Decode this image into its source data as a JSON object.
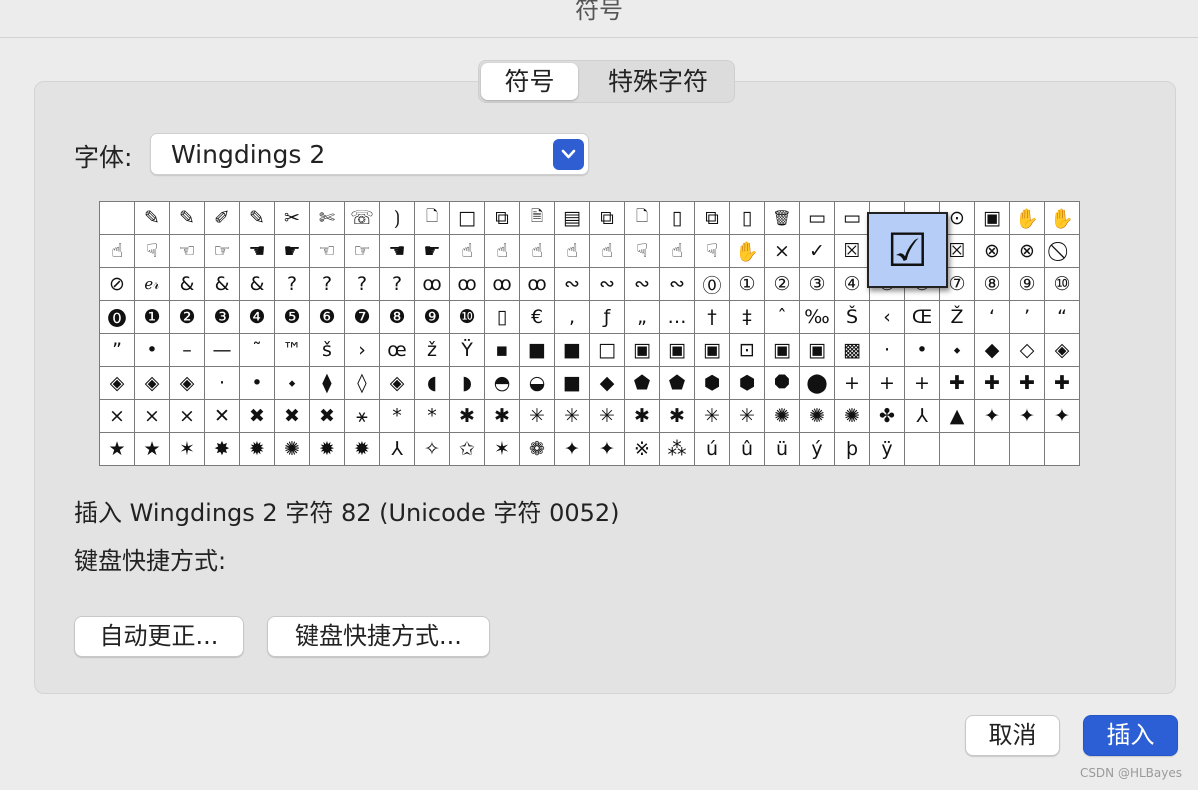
{
  "window": {
    "title": "符号"
  },
  "tabs": [
    {
      "label": "符号",
      "active": true
    },
    {
      "label": "特殊字符",
      "active": false
    }
  ],
  "font": {
    "label": "字体:",
    "value": "Wingdings 2"
  },
  "grid": {
    "rows": [
      [
        "",
        "✎",
        "✎",
        "✐",
        "✎",
        "✂",
        "✄",
        "☏",
        "⟯",
        "🗋",
        "□",
        "⧉",
        "🗎",
        "▤",
        "⧉",
        "🗋",
        "▯",
        "⧉",
        "▯",
        "🗑",
        "▭",
        "▭",
        "▭",
        "▭",
        "⊙",
        "▣",
        "✋",
        "✋"
      ],
      [
        "☝",
        "☟",
        "☜",
        "☞",
        "☚",
        "☛",
        "☜",
        "☞",
        "☚",
        "☛",
        "☝",
        "☝",
        "☝",
        "☝",
        "☝",
        "☟",
        "☝",
        "☟",
        "✋",
        "×",
        "✓",
        "☒",
        "☑",
        "☐",
        "☒",
        "⊗",
        "⊗",
        "⃠"
      ],
      [
        "⊘",
        "ℯ𝓇",
        "&",
        "&",
        "&",
        "?",
        "?",
        "?",
        "?",
        "ꝏ",
        "ꝏ",
        "ꝏ",
        "ꝏ",
        "∾",
        "∾",
        "∾",
        "∾",
        "⓪",
        "①",
        "②",
        "③",
        "④",
        "⑤",
        "⑥",
        "⑦",
        "⑧",
        "⑨",
        "⑩"
      ],
      [
        "⓿",
        "❶",
        "❷",
        "❸",
        "❹",
        "❺",
        "❻",
        "❼",
        "❽",
        "❾",
        "❿",
        "▯",
        "€",
        ",",
        "ƒ",
        "„",
        "…",
        "†",
        "‡",
        "ˆ",
        "‰",
        "Š",
        "‹",
        "Œ",
        "Ž",
        "‘",
        "’",
        "“"
      ],
      [
        "”",
        "•",
        "–",
        "—",
        "˜",
        "™",
        "š",
        "›",
        "œ",
        "ž",
        "Ÿ",
        "▪",
        "■",
        "■",
        "□",
        "▣",
        "▣",
        "▣",
        "⊡",
        "▣",
        "▣",
        "▩",
        "·",
        "•",
        "⬩",
        "◆",
        "◇",
        "◈"
      ],
      [
        "◈",
        "◈",
        "◈",
        "·",
        "•",
        "⬩",
        "⧫",
        "◊",
        "◈",
        "◖",
        "◗",
        "◓",
        "◒",
        "■",
        "◆",
        "⬟",
        "⬟",
        "⬢",
        "⬢",
        "⯃",
        "⬤",
        "+",
        "+",
        "+",
        "✚",
        "✚",
        "✚",
        "✚"
      ],
      [
        "×",
        "×",
        "×",
        "✕",
        "✖",
        "✖",
        "✖",
        "⚹",
        "*",
        "*",
        "✱",
        "✱",
        "✳",
        "✳",
        "✳",
        "✱",
        "✱",
        "✳",
        "✳",
        "✺",
        "✺",
        "✺",
        "✤",
        "⅄",
        "▲",
        "✦",
        "✦",
        "✦"
      ],
      [
        "★",
        "★",
        "✶",
        "✸",
        "✹",
        "✺",
        "✹",
        "✹",
        "⅄",
        "✧",
        "✩",
        "✶",
        "❁",
        "✦",
        "✦",
        "※",
        "⁂",
        "ú",
        "û",
        "ü",
        "ý",
        "þ",
        "ÿ",
        "",
        "",
        "",
        "",
        ""
      ]
    ],
    "selected_glyph": "☑"
  },
  "info": {
    "text": "插入 Wingdings 2 字符 82 (Unicode 字符 0052)"
  },
  "shortcut": {
    "label": "键盘快捷方式:"
  },
  "buttons": {
    "autocorrect": "自动更正...",
    "shortcut": "键盘快捷方式...",
    "cancel": "取消",
    "insert": "插入"
  },
  "watermark": "CSDN @HLBayes",
  "colors": {
    "accent": "#2c5fd6",
    "selection": "#b5cdf7"
  }
}
